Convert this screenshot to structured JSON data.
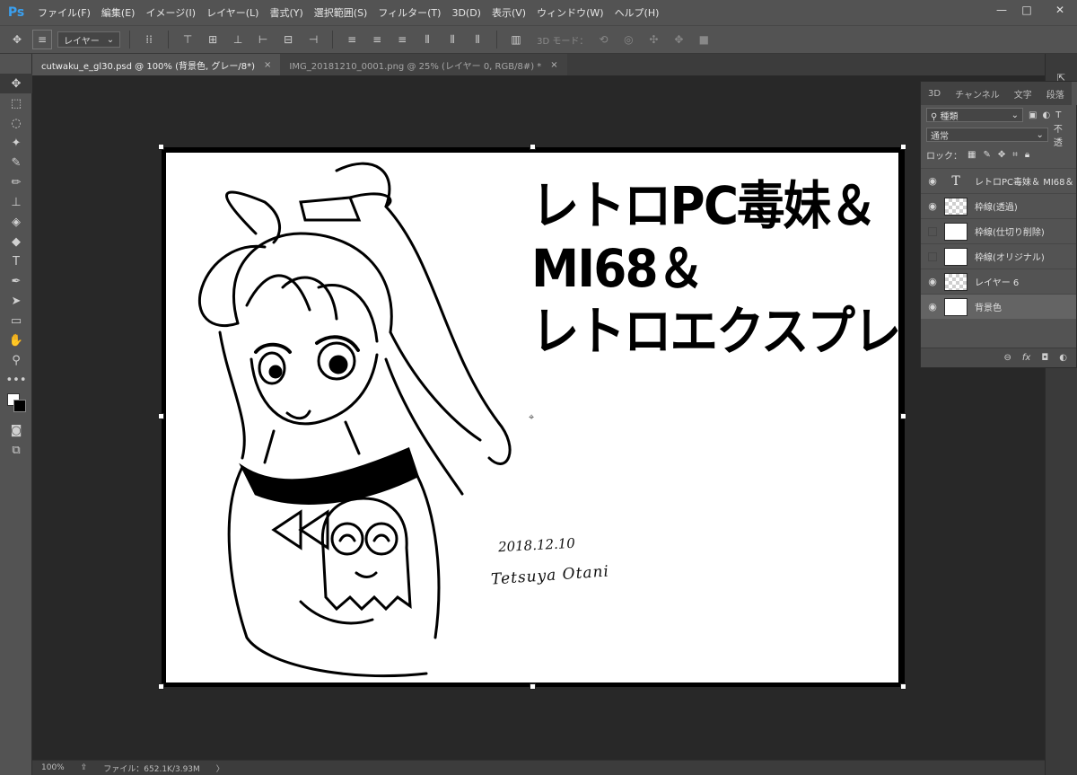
{
  "app": {
    "logo": "Ps"
  },
  "menu": [
    "ファイル(F)",
    "編集(E)",
    "イメージ(I)",
    "レイヤー(L)",
    "書式(Y)",
    "選択範囲(S)",
    "フィルター(T)",
    "3D(D)",
    "表示(V)",
    "ウィンドウ(W)",
    "ヘルプ(H)"
  ],
  "window_controls": {
    "minimize": "—",
    "maximize": "□",
    "close": "✕"
  },
  "options": {
    "layer_select": "レイヤー",
    "mode3d_label": "3D モード："
  },
  "tabs": [
    {
      "label": "cutwaku_e_gl30.psd @ 100% (背景色, グレー/8*)",
      "close": "×"
    },
    {
      "label": "IMG_20181210_0001.png @ 25% (レイヤー 0, RGB/8#) *",
      "close": "×"
    }
  ],
  "canvas": {
    "title_lines": [
      "レトロPC毒妹＆",
      "MI68＆",
      "レトロエクスプレス"
    ],
    "date": "2018.12.10",
    "signature": "Tetsuya Otani"
  },
  "layers_panel": {
    "tabs": [
      "3D",
      "チャンネル",
      "文字",
      "段落",
      "レ"
    ],
    "filter_label": "種類",
    "blend_mode": "通常",
    "opacity_label": "不透",
    "lock_label": "ロック：",
    "layers": [
      {
        "name": "レトロPC毒妹＆ MI68＆",
        "visible": true,
        "thumb": "text"
      },
      {
        "name": "枠線(透過)",
        "visible": true,
        "thumb": "checker"
      },
      {
        "name": "枠線(仕切り削除)",
        "visible": false,
        "thumb": "white"
      },
      {
        "name": "枠線(オリジナル)",
        "visible": false,
        "thumb": "white"
      },
      {
        "name": "レイヤー 6",
        "visible": true,
        "thumb": "checker"
      },
      {
        "name": "背景色",
        "visible": true,
        "thumb": "white",
        "selected": true
      }
    ],
    "footer_icons": [
      "link-icon",
      "fx-icon",
      "mask-icon",
      "adjustment-icon"
    ]
  },
  "status": {
    "zoom": "100%",
    "file_info": "ファイル：652.1K/3.93M",
    "arrow": "〉"
  }
}
